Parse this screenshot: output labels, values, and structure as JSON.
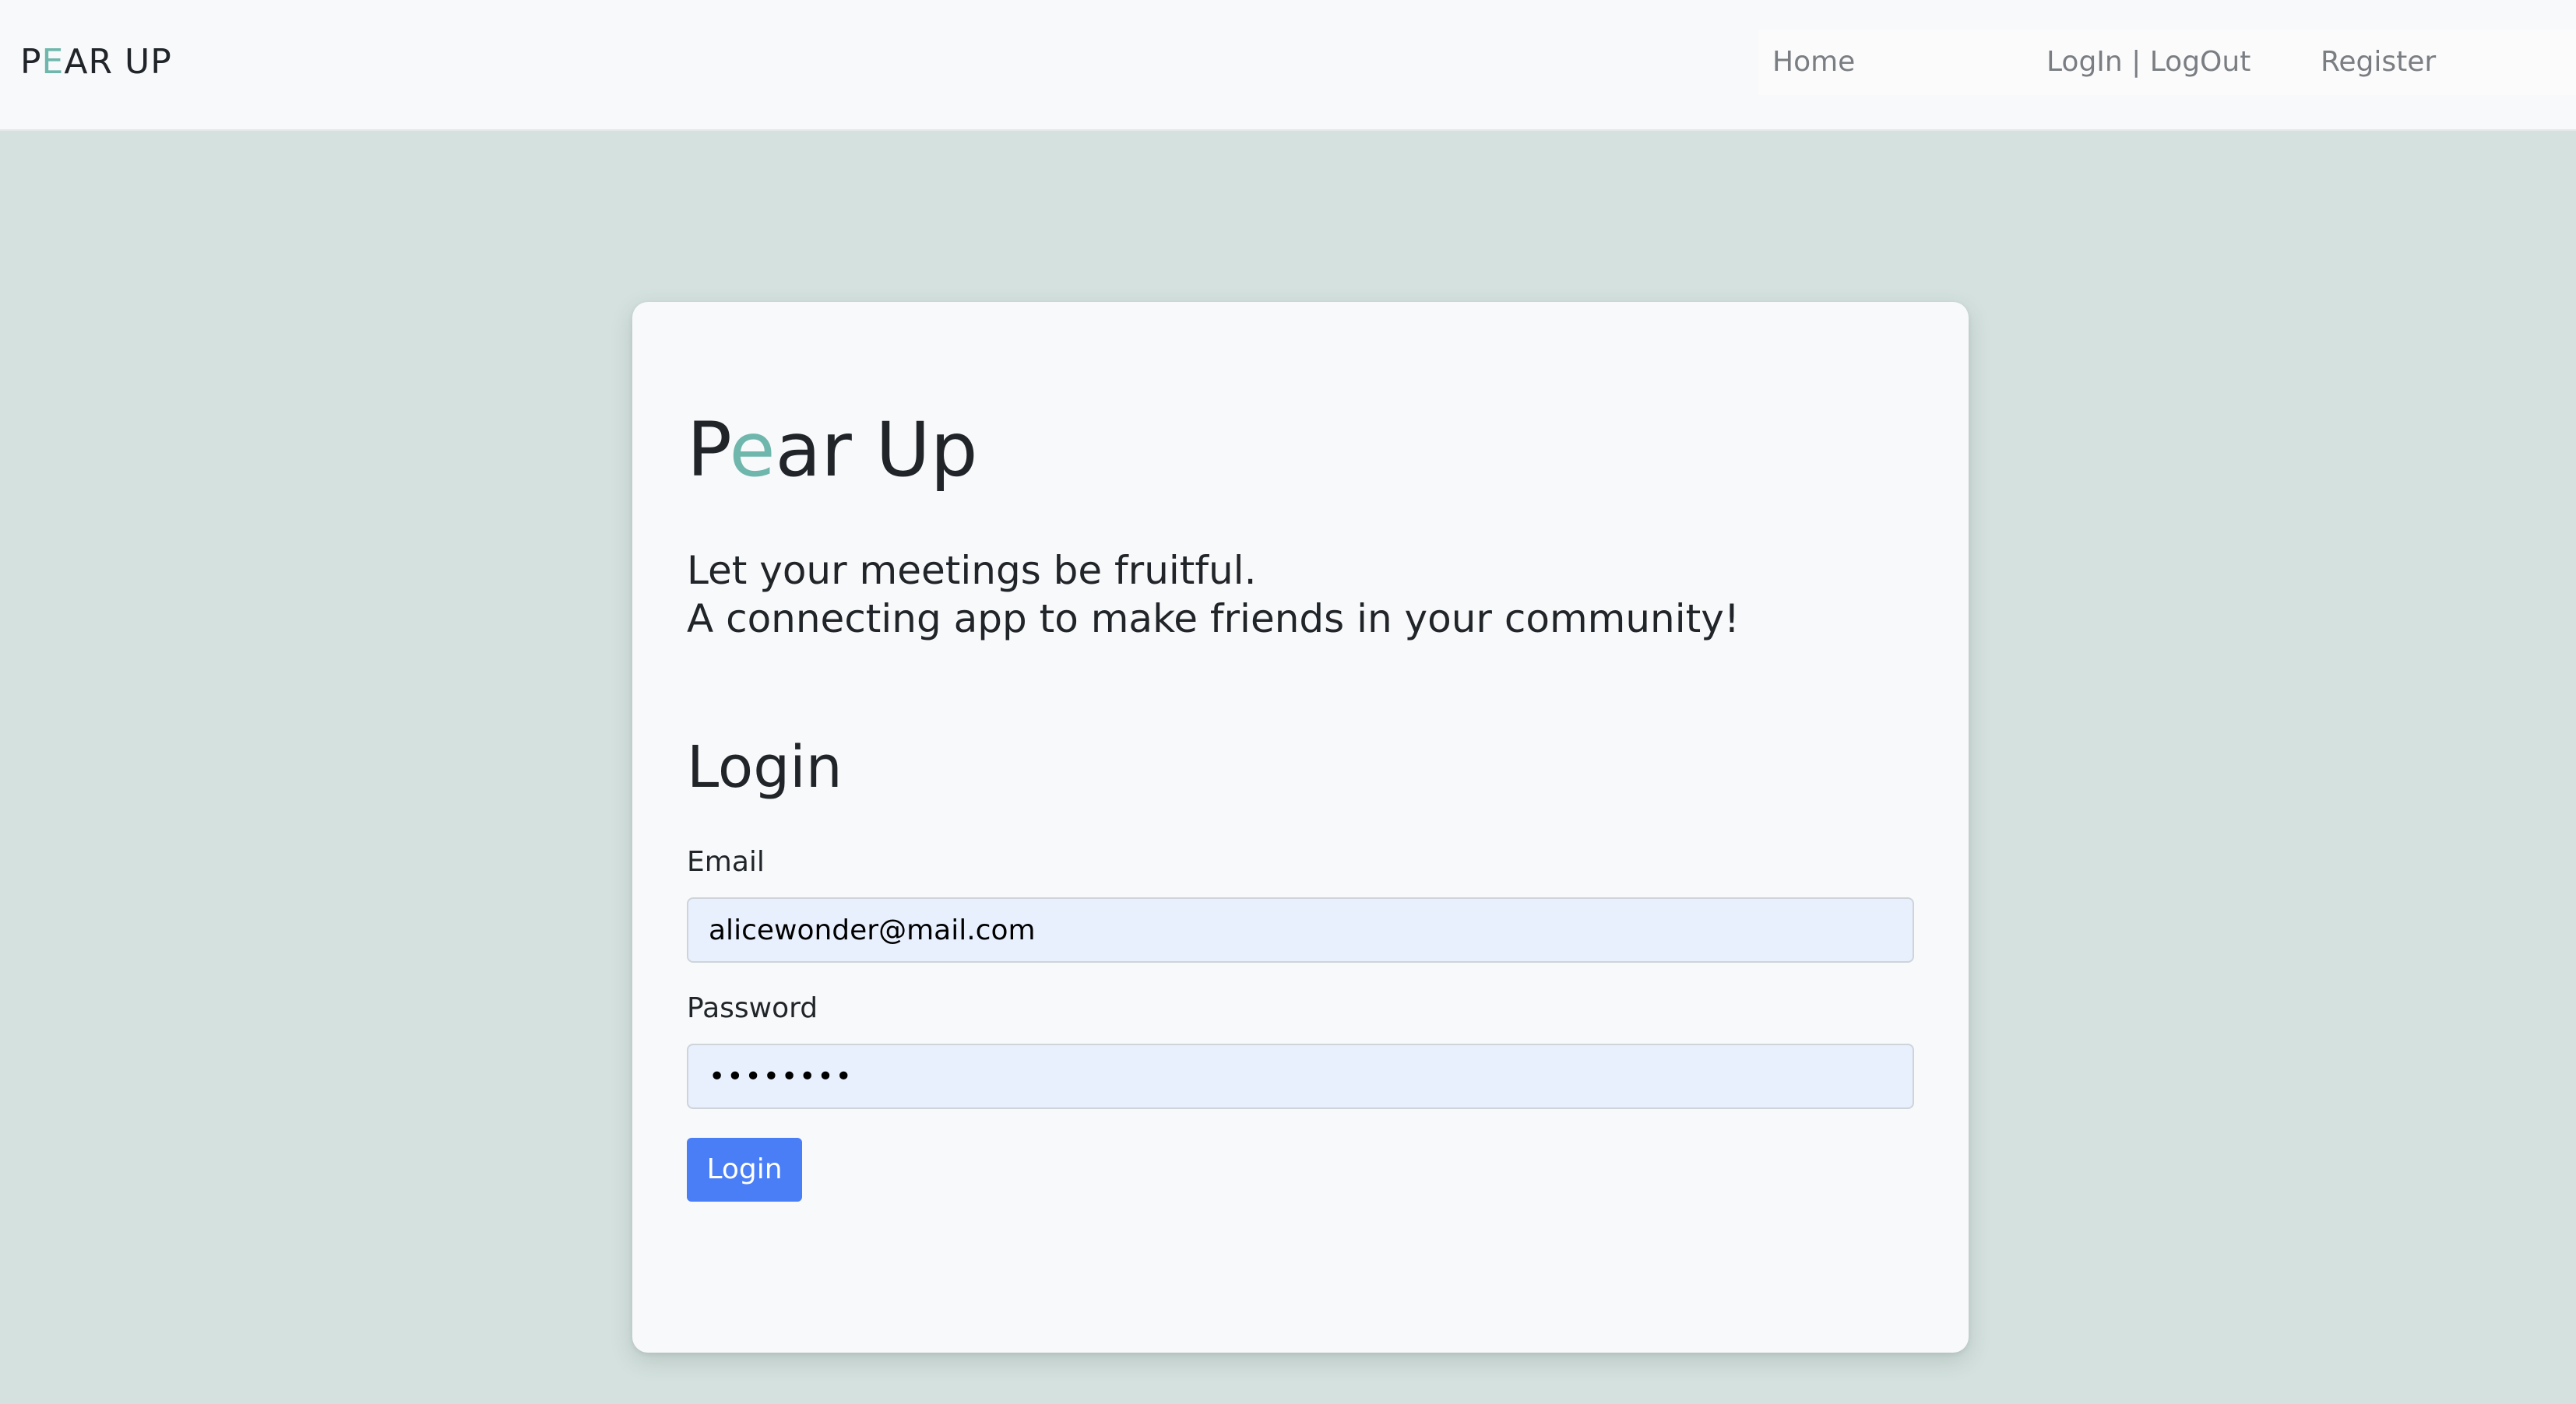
{
  "navbar": {
    "brand": {
      "first": "P",
      "accent": "E",
      "rest": "AR UP"
    },
    "links": {
      "home": "Home",
      "login_logout": "LogIn | LogOut",
      "register": "Register"
    }
  },
  "card": {
    "title": {
      "first": "P",
      "accent": "e",
      "rest": "ar Up"
    },
    "tagline": {
      "line1": "Let your meetings be fruitful.",
      "line2": "A connecting app to make friends in your community!"
    },
    "form": {
      "heading": "Login",
      "email_label": "Email",
      "email_value": "alicewonder@mail.com",
      "password_label": "Password",
      "password_value": "••••••••",
      "submit_label": "Login"
    }
  },
  "colors": {
    "page_background": "#d4e1de",
    "accent": "#6fb7ac",
    "button": "#4a7ef7",
    "input_autofill": "#e8f0fe"
  }
}
